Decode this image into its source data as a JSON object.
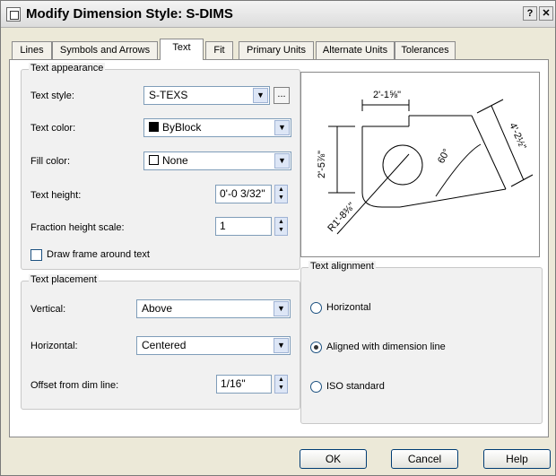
{
  "window": {
    "title": "Modify Dimension Style: S-DIMS",
    "help_glyph": "?",
    "close_glyph": "✕"
  },
  "tabs": [
    {
      "label": "Lines"
    },
    {
      "label": "Symbols and Arrows"
    },
    {
      "label": "Text"
    },
    {
      "label": "Fit"
    },
    {
      "label": "Primary Units"
    },
    {
      "label": "Alternate Units"
    },
    {
      "label": "Tolerances"
    }
  ],
  "active_tab": "Text",
  "appearance": {
    "legend": "Text appearance",
    "style_label": "Text style:",
    "style_value": "S-TEXS",
    "browse_label": "...",
    "color_label": "Text color:",
    "color_value": "ByBlock",
    "fill_label": "Fill color:",
    "fill_value": "None",
    "height_label": "Text height:",
    "height_value": "0'-0 3/32\"",
    "fraction_label": "Fraction height scale:",
    "fraction_value": "1",
    "frame_label": "Draw frame around text",
    "frame_checked": false
  },
  "placement": {
    "legend": "Text placement",
    "vertical_label": "Vertical:",
    "vertical_value": "Above",
    "horizontal_label": "Horizontal:",
    "horizontal_value": "Centered",
    "offset_label": "Offset from dim line:",
    "offset_value": "1/16\""
  },
  "alignment": {
    "legend": "Text alignment",
    "options": [
      "Horizontal",
      "Aligned with dimension line",
      "ISO standard"
    ],
    "selected": "Aligned with dimension line"
  },
  "preview": {
    "dim_top": "2'-1⅝\"",
    "dim_left": "2'-5⅞\"",
    "dim_right": "4'-2½\"",
    "dim_angle": "60°",
    "dim_radius": "R1'-8⅜\""
  },
  "buttons": {
    "ok": "OK",
    "cancel": "Cancel",
    "help": "Help"
  },
  "colors": {
    "byblock_swatch": "#000000",
    "none_swatch": "#ffffff"
  },
  "icons": {
    "dropdown": "chevron-down-icon",
    "spin_up": "spin-up-icon",
    "spin_down": "spin-down-icon"
  }
}
